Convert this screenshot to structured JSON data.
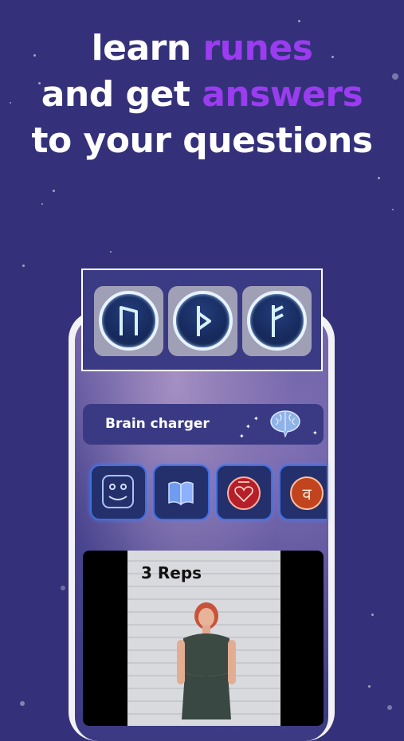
{
  "headline": {
    "line1_plain": "learn ",
    "line1_accent": "runes",
    "line2_plain": "and get ",
    "line2_accent": "answers",
    "line3": "to your questions"
  },
  "rune_tiles": [
    {
      "icon": "rune-uruz-icon"
    },
    {
      "icon": "rune-thurisaz-icon"
    },
    {
      "icon": "rune-ansuz-icon"
    }
  ],
  "brain_card": {
    "label": "Brain charger",
    "icon": "brain-icon"
  },
  "category_tiles": [
    {
      "icon": "smiley-face-icon"
    },
    {
      "icon": "open-book-icon"
    },
    {
      "icon": "heart-chakra-icon"
    },
    {
      "icon": "sacral-chakra-icon"
    }
  ],
  "video": {
    "overlay_text": "3 Reps"
  },
  "colors": {
    "background": "#34317a",
    "accent": "#9b3cf0",
    "glow": "#3f6fe0"
  }
}
